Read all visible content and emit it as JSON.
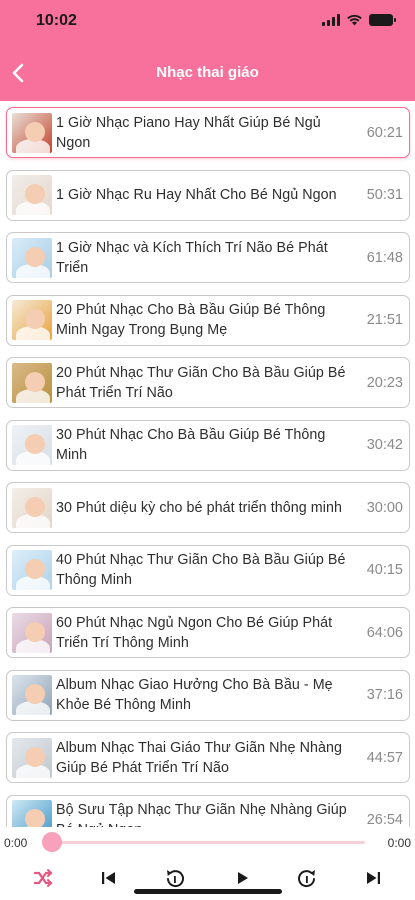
{
  "status_bar": {
    "time": "10:02"
  },
  "nav": {
    "title": "Nhạc thai giáo"
  },
  "colors": {
    "header": "#f7719c",
    "active_border": "#f06f8f",
    "progress": "#f7a1bb"
  },
  "tracks": [
    {
      "title": "1 Giờ Nhạc Piano Hay Nhất Giúp Bé Ngủ Ngon",
      "duration": "60:21",
      "active": true
    },
    {
      "title": "1 Giờ Nhạc Ru Hay Nhất Cho Bé Ngủ Ngon",
      "duration": "50:31"
    },
    {
      "title": "1 Giờ Nhạc và Kích Thích Trí Não Bé Phát Triển",
      "duration": "61:48"
    },
    {
      "title": "20 Phút Nhạc Cho Bà Bầu Giúp Bé Thông Minh Ngay Trong Bụng Mẹ",
      "duration": "21:51"
    },
    {
      "title": "20 Phút Nhạc Thư Giãn Cho Bà Bầu Giúp Bé Phát Triển Trí Não",
      "duration": "20:23"
    },
    {
      "title": "30 Phút Nhạc Cho Bà Bầu Giúp Bé Thông Minh",
      "duration": "30:42"
    },
    {
      "title": "30 Phút diệu kỳ cho bé phát triển thông minh",
      "duration": "30:00"
    },
    {
      "title": "40 Phút Nhạc Thư Giãn Cho Bà Bầu Giúp Bé Thông Minh",
      "duration": "40:15"
    },
    {
      "title": "60 Phút Nhạc Ngủ Ngon Cho Bé Giúp Phát Triển Trí Thông Minh",
      "duration": "64:06"
    },
    {
      "title": "Album Nhạc Giao Hưởng Cho Bà Bầu - Mẹ Khỏe Bé Thông Minh",
      "duration": "37:16"
    },
    {
      "title": "Album Nhạc Thai Giáo Thư Giãn Nhẹ Nhàng Giúp Bé Phát Triển Trí Não",
      "duration": "44:57"
    },
    {
      "title": "Bộ Sưu Tập Nhạc Thư Giãn Nhẹ Nhàng Giúp Bé Ngủ Ngon",
      "duration": "26:54"
    }
  ],
  "player": {
    "current_time": "0:00",
    "total_time": "0:00",
    "progress": 0,
    "icons": [
      "shuffle-icon",
      "previous-icon",
      "rewind-icon",
      "play-icon",
      "forward-icon",
      "next-icon"
    ]
  }
}
